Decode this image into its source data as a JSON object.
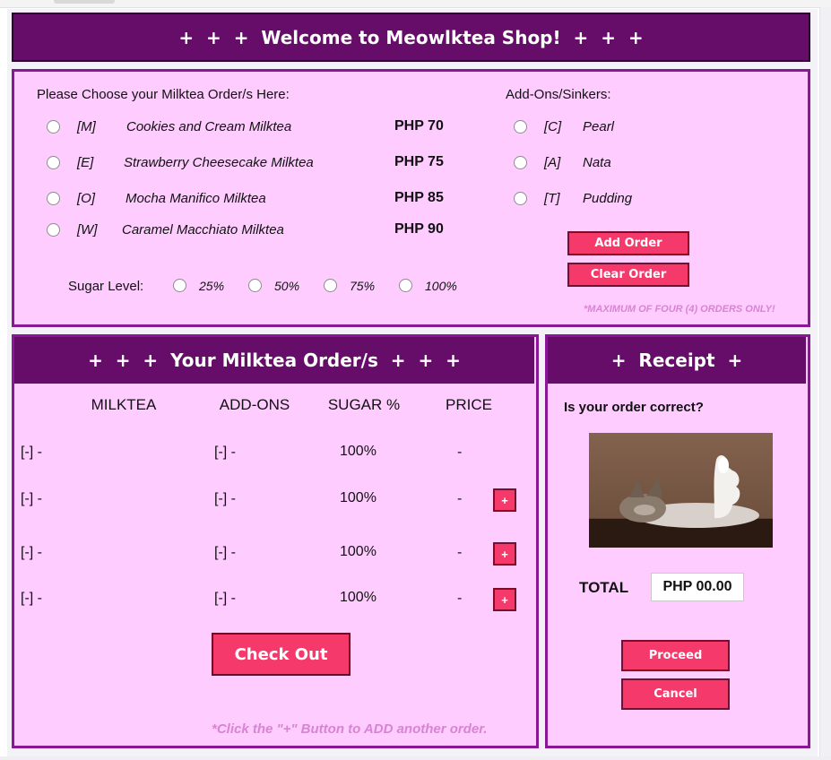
{
  "header": {
    "title": "+  +  +  Welcome to Meowlktea Shop!  +  +  +"
  },
  "order_form": {
    "milktea_heading": "Please Choose your Milktea Order/s Here:",
    "milkteas": [
      {
        "code": "[M]",
        "name": "Cookies and Cream Milktea",
        "price": "PHP 70"
      },
      {
        "code": "[E]",
        "name": "Strawberry Cheesecake Milktea",
        "price": "PHP 75"
      },
      {
        "code": "[O]",
        "name": "Mocha Manifico Milktea",
        "price": "PHP 85"
      },
      {
        "code": "[W]",
        "name": "Caramel Macchiato Milktea",
        "price": "PHP 90"
      }
    ],
    "addons_heading": "Add-Ons/Sinkers:",
    "addons": [
      {
        "code": "[C]",
        "name": "Pearl"
      },
      {
        "code": "[A]",
        "name": "Nata"
      },
      {
        "code": "[T]",
        "name": "Pudding"
      }
    ],
    "sugar_label": "Sugar Level:",
    "sugar_levels": [
      "25%",
      "50%",
      "75%",
      "100%"
    ],
    "add_order_label": "Add Order",
    "clear_order_label": "Clear Order",
    "max_note": "*MAXIMUM OF FOUR (4) ORDERS ONLY!"
  },
  "orders": {
    "title": "+  +  +  Your Milktea Order/s  +  +  +",
    "columns": [
      "MILKTEA",
      "ADD-ONS",
      "SUGAR %",
      "PRICE"
    ],
    "rows": [
      {
        "milktea": "[-] -",
        "addons": "[-] -",
        "sugar": "100%",
        "price": "-",
        "plus": ""
      },
      {
        "milktea": "[-] -",
        "addons": "[-] -",
        "sugar": "100%",
        "price": "-",
        "plus": "+"
      },
      {
        "milktea": "[-] -",
        "addons": "[-] -",
        "sugar": "100%",
        "price": "-",
        "plus": "+"
      },
      {
        "milktea": "[-] -",
        "addons": "[-] -",
        "sugar": "100%",
        "price": "-",
        "plus": "+"
      }
    ],
    "checkout_label": "Check Out",
    "footer_note": "*Click the \"+\" Button to ADD another order."
  },
  "receipt": {
    "title": "+  Receipt  +",
    "question": "Is your order correct?",
    "total_label": "TOTAL",
    "total_value": "PHP 00.00",
    "proceed_label": "Proceed",
    "cancel_label": "Cancel"
  },
  "colors": {
    "panel_bg": "#ffccff",
    "panel_border": "#8a1796",
    "title_bg": "#650d68",
    "button_bg": "#f6396b",
    "button_border": "#7b0d2c",
    "note_color": "#d784d2"
  }
}
